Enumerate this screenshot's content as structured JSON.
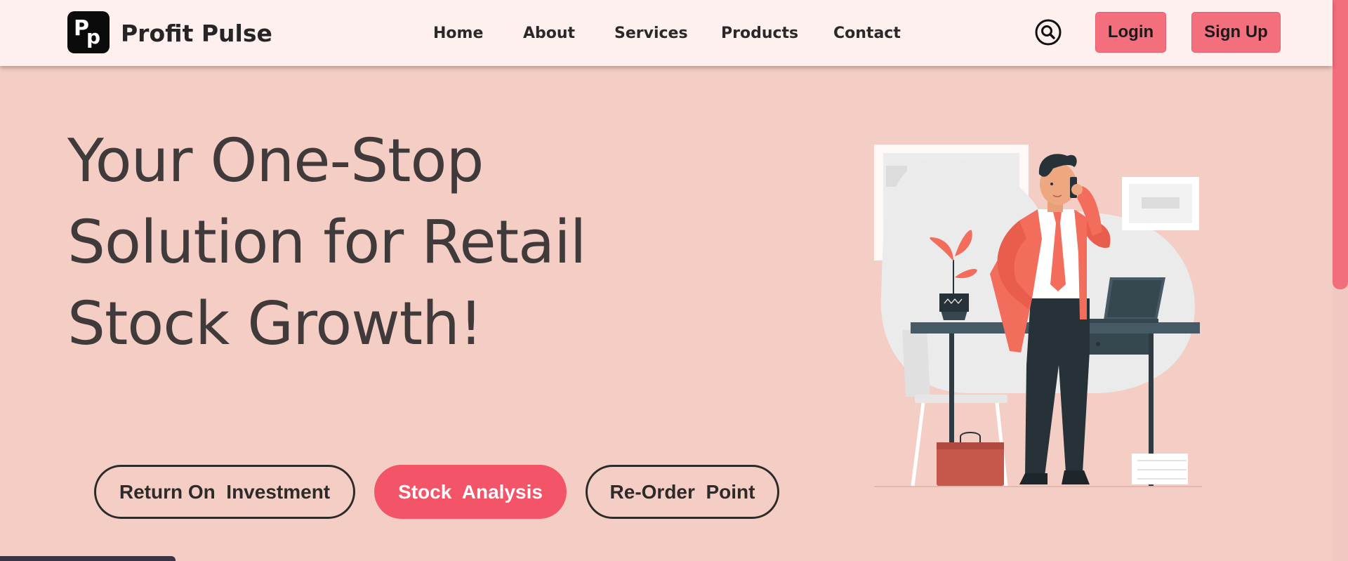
{
  "brand": {
    "name": "Profit Pulse",
    "logo_letters": [
      "P",
      "p"
    ]
  },
  "nav": {
    "links": [
      "Home",
      "About",
      "Services",
      "Products",
      "Contact"
    ],
    "search_icon": "search-icon",
    "login_label": "Login",
    "signup_label": "Sign Up"
  },
  "hero": {
    "title_lines": [
      "Your One-Stop",
      "Solution for Retail",
      "Stock Growth!"
    ],
    "buttons": [
      "Return On  Investment",
      "Stock  Analysis",
      "Re-Order  Point"
    ]
  },
  "colors": {
    "background": "#f4cdc4",
    "navbar": "#fff0f0",
    "accent": "#f45467",
    "nav_button": "#f46f7e"
  }
}
